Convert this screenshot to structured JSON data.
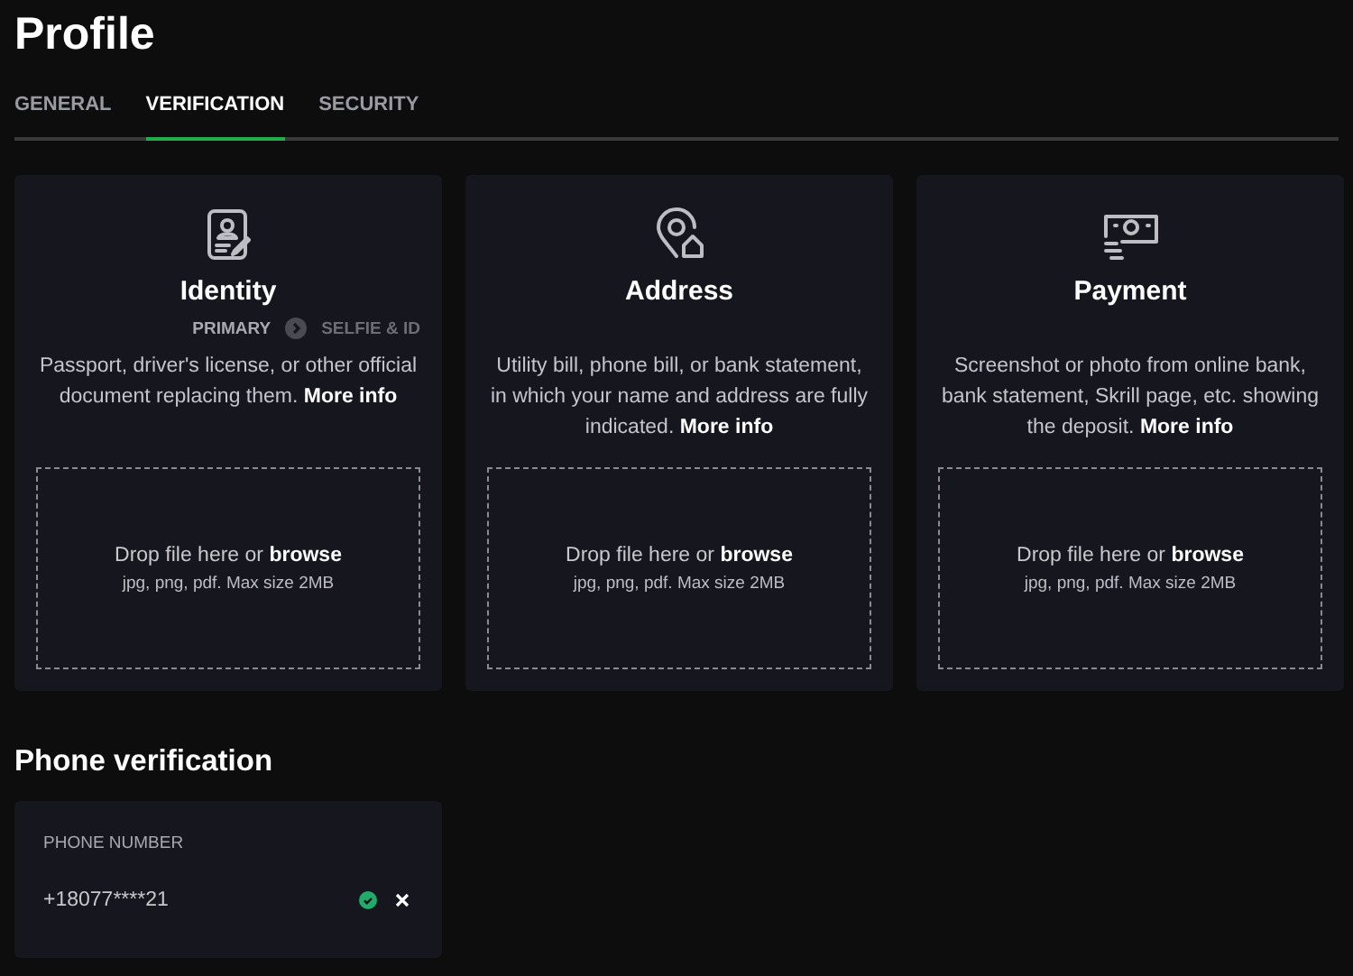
{
  "title": "Profile",
  "tabs": [
    {
      "label": "GENERAL",
      "selected": false
    },
    {
      "label": "VERIFICATION",
      "selected": true
    },
    {
      "label": "SECURITY",
      "selected": false
    }
  ],
  "documents": [
    {
      "kind": "identity",
      "title": "Identity",
      "steps": [
        {
          "label": "PRIMARY",
          "selected": true
        },
        {
          "label": "SELFIE & ID",
          "selected": false
        }
      ],
      "description": "Passport, driver's license, or other official document replacing them.",
      "link": "More info",
      "drop_text": "Drop file here or",
      "browse": "browse",
      "hint": "jpg, png, pdf. Max size 2MB"
    },
    {
      "kind": "address",
      "title": "Address",
      "description": "Utility bill, phone bill, or bank statement, in which your name and address are fully indicated.",
      "link": "More info",
      "drop_text": "Drop file here or",
      "browse": "browse",
      "hint": "jpg, png, pdf. Max size 2MB"
    },
    {
      "kind": "payment",
      "title": "Payment",
      "description": "Screenshot or photo from online bank, bank statement, Skrill page, etc. showing the deposit.",
      "link": "More info",
      "drop_text": "Drop file here or",
      "browse": "browse",
      "hint": "jpg, png, pdf. Max size 2MB"
    }
  ],
  "phone": {
    "heading": "Phone verification",
    "label": "PHONE NUMBER",
    "value": "+18077****21",
    "verified": true
  }
}
